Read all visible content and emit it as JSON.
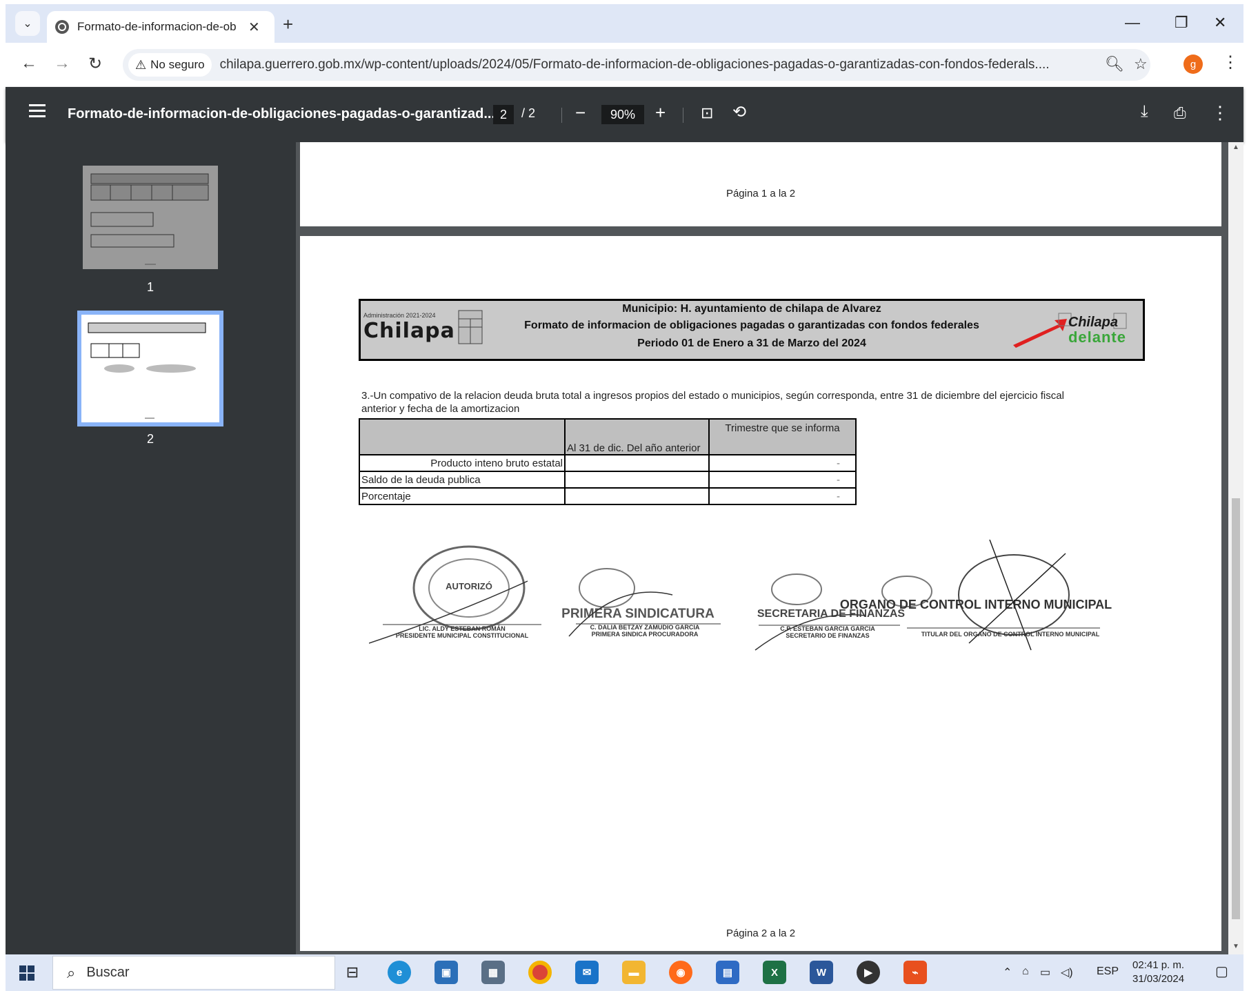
{
  "browser": {
    "tab_title": "Formato-de-informacion-de-ob",
    "security_label": "No seguro",
    "url": "chilapa.guerrero.gob.mx/wp-content/uploads/2024/05/Formato-de-informacion-de-obligaciones-pagadas-o-garantizadas-con-fondos-federals....",
    "profile_initial": "g"
  },
  "pdf_toolbar": {
    "title": "Formato-de-informacion-de-obligaciones-pagadas-o-garantizad...",
    "current_page": "2",
    "page_separator": "/",
    "total_pages": "2",
    "zoom": "90%"
  },
  "sidebar": {
    "thumbnails": [
      {
        "label": "1",
        "selected": false
      },
      {
        "label": "2",
        "selected": true
      }
    ]
  },
  "page1": {
    "footer": "Página 1 a la 2"
  },
  "page2": {
    "header": {
      "logo_small": "Administración 2021-2024",
      "logo_big": "Chilapa",
      "line1": "Municipio: H. ayuntamiento de chilapa de Alvarez",
      "line2": "Formato de informacion de obligaciones pagadas o garantizadas con fondos federales",
      "line3": "Periodo 01 de Enero a 31 de Marzo del 2024",
      "logo_right_top": "Chilapa",
      "logo_right_bottom": "delante"
    },
    "intro": "3.-Un compativo de la relacion deuda bruta total a ingresos propios del estado o municipios, según corresponda, entre 31 de diciembre del ejercicio fiscal anterior y fecha de la amortizacion",
    "table": {
      "col1_header": "",
      "col2_header": "Al 31 de dic. Del año anterior",
      "col3_header": "Trimestre que se informa",
      "rows": [
        {
          "label": "Producto inteno bruto estatal",
          "prior": "",
          "quarter": "-"
        },
        {
          "label": "Saldo de la deuda publica",
          "prior": "",
          "quarter": "-"
        },
        {
          "label": "Porcentaje",
          "prior": "",
          "quarter": "-"
        }
      ]
    },
    "signatures": {
      "sig1_name": "LIC. ALDY ESTEBAN ROMÁN",
      "sig1_role": "PRESIDENTE MUNICIPAL CONSTITUCIONAL",
      "sig2_name": "C. DALIA BETZAY ZAMUDIO GARCIA",
      "sig2_role": "PRIMERA SINDICA PROCURADORA",
      "sig3_name": "C.P. ESTEBAN GARCIA GARCIA",
      "sig3_role": "SECRETARIO DE FINANZAS",
      "sig4_role": "TITULAR DEL ORGANO DE CONTROL INTERNO MUNICIPAL",
      "stamp1": "AUTORIZÓ",
      "stamp2": "PRIMERA SINDICATURA",
      "stamp3": "SECRETARIA DE FINANZAS",
      "stamp4": "ORGANO DE CONTROL INTERNO MUNICIPAL"
    },
    "footer": "Página 2 a la 2"
  },
  "taskbar": {
    "search_placeholder": "Buscar",
    "language": "ESP",
    "time": "02:41 p. m.",
    "date": "31/03/2024"
  },
  "colors": {
    "pdf_toolbar_bg": "#323639",
    "viewer_bg": "#525659",
    "thumb_selected": "#8ab4f8",
    "header_box_bg": "#c9c9c9",
    "chrome_frame": "#dfe7f6"
  }
}
